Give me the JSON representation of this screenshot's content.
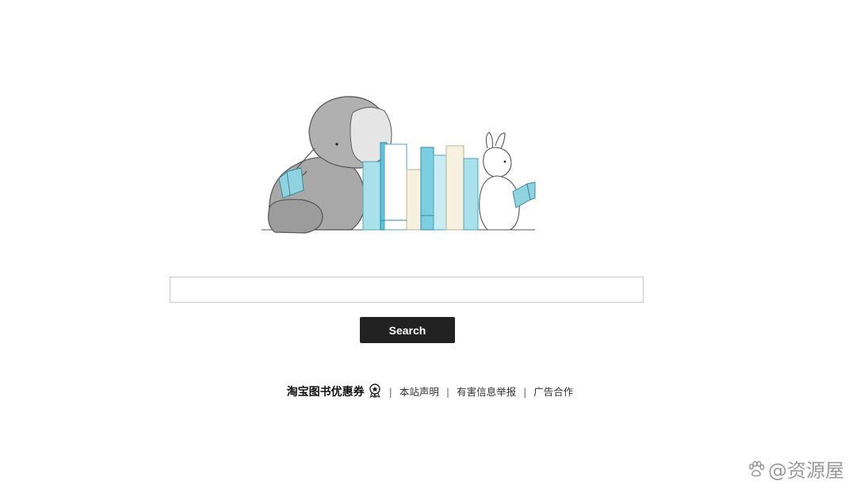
{
  "search": {
    "placeholder": "",
    "value": "",
    "button_label": "Search"
  },
  "footer": {
    "links": [
      "淘宝图书优惠券",
      "本站声明",
      "有害信息举报",
      "广告合作"
    ],
    "separator": "|"
  },
  "watermark": {
    "text": "@资源屋"
  },
  "icons": {
    "badge": "award-badge-icon",
    "paw": "paw-icon"
  },
  "colors": {
    "button_bg": "#222222",
    "button_text": "#ffffff",
    "input_border": "#c8c8c8",
    "book_blue": "#7ccfe0",
    "book_cream": "#f6f2df",
    "elephant_gray": "#9a9a9a"
  }
}
